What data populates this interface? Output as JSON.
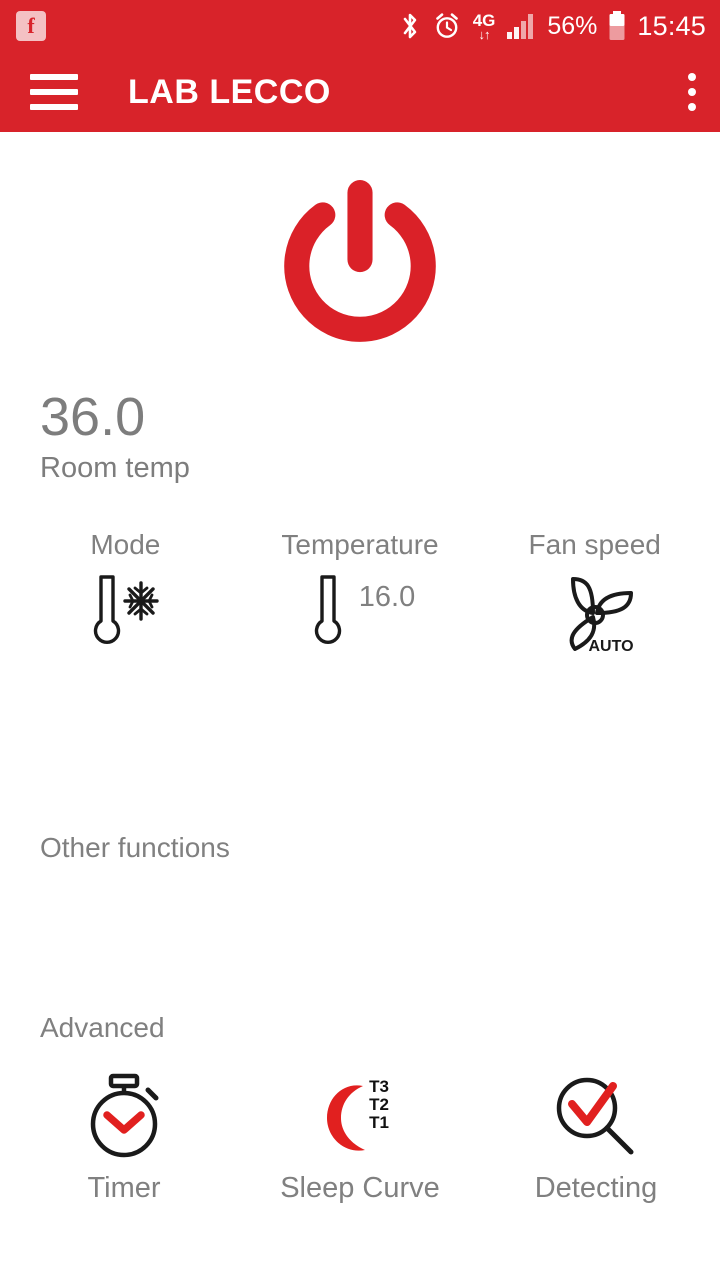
{
  "theme": {
    "brand_red": "#D8232A",
    "icon_red": "#E1201F",
    "text_gray": "#808080",
    "icon_black": "#1a1a1a"
  },
  "status_bar": {
    "notification_icon": "facebook-icon",
    "notification_glyph": "f",
    "bluetooth_icon": "bluetooth-icon",
    "alarm_icon": "alarm-clock-icon",
    "network_label": "4G",
    "network_arrows": "↓↑",
    "signal_icon": "signal-bars-icon",
    "battery_percent": "56%",
    "battery_icon": "battery-icon",
    "clock": "15:45"
  },
  "app_bar": {
    "menu_icon": "hamburger-menu-icon",
    "title": "LAB LECCO",
    "overflow_icon": "overflow-menu-icon"
  },
  "power": {
    "icon": "power-button-icon",
    "state": "on"
  },
  "room": {
    "temperature": "36.0",
    "label": "Room temp"
  },
  "controls": [
    {
      "label": "Mode",
      "icon": "thermometer-snowflake-icon",
      "value": ""
    },
    {
      "label": "Temperature",
      "icon": "thermometer-icon",
      "value": "16.0"
    },
    {
      "label": "Fan speed",
      "icon": "fan-propeller-icon",
      "value": "AUTO"
    }
  ],
  "sections": {
    "other_functions": "Other functions",
    "advanced": "Advanced"
  },
  "advanced_items": [
    {
      "label": "Timer",
      "icon": "stopwatch-icon"
    },
    {
      "label": "Sleep Curve",
      "icon": "crescent-moon-icon",
      "markers": [
        "T3",
        "T2",
        "T1"
      ]
    },
    {
      "label": "Detecting",
      "icon": "magnifier-check-icon"
    }
  ]
}
